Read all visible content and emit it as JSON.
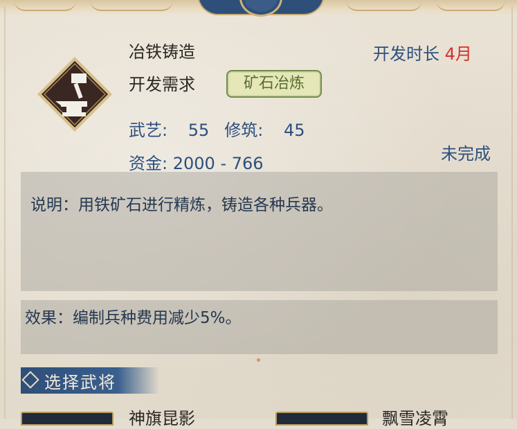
{
  "tech": {
    "name": "冶铁铸造",
    "requirement_label": "开发需求",
    "requirement_badge": "矿石冶炼",
    "dev_time_label": "开发时长",
    "dev_time_value": "4月",
    "stats": {
      "martial_label": "武艺:",
      "martial_value": "55",
      "build_label": "修筑:",
      "build_value": "45"
    },
    "funds_label": "资金:",
    "funds_value": "2000 - 766",
    "status": "未完成",
    "description": "说明：用铁矿石进行精炼，铸造各种兵器。",
    "effect": "效果：编制兵种费用减少5%。",
    "icon": "anvil-hammer-icon"
  },
  "section": {
    "title": "选择武将"
  },
  "generals": [
    {
      "name": "神旗昆影"
    },
    {
      "name": "飘雪凌霄"
    }
  ],
  "colors": {
    "accent_blue": "#2c4f7e",
    "highlight_red": "#d2302a",
    "badge_green": "#6f8b4a"
  }
}
